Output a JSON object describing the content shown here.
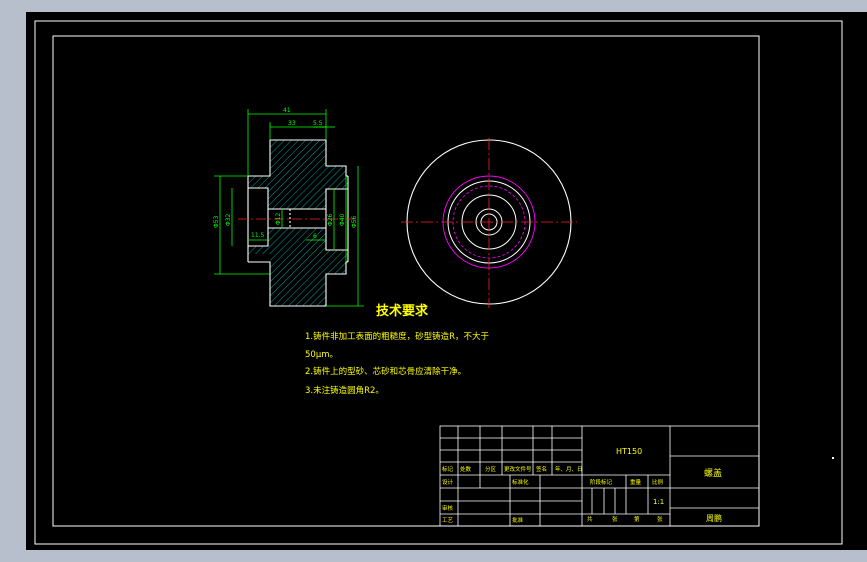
{
  "colors": {
    "background": "#000000",
    "frame": "#ffffff",
    "outline": "#ffffff",
    "dimension": "#00ff00",
    "hatch": "#00c8c8",
    "centerline": "#ff2020",
    "pitch": "#ff00ff",
    "note_text": "#ffff00"
  },
  "dimensions": {
    "overall_length": "41",
    "hub_length": "33",
    "step_length": "5.5",
    "bore_depth": "11.5",
    "inner_step": "6",
    "dia_left_outer": "Φ53",
    "dia_left_inner": "Φ32",
    "dia_bore": "Φ12",
    "dia_right_inner": "Φ26",
    "dia_right_mid": "Φ40",
    "dia_right_outer": "Φ56"
  },
  "notes": {
    "title": "技术要求",
    "line1": "1.铸件非加工表面的粗糙度，砂型铸造R，不大于",
    "line2": "50μm。",
    "line3": "2.铸件上的型砂、芯砂和芯骨应清除干净。",
    "line4": "3.未注铸造圆角R2。"
  },
  "title_block": {
    "material": "HT150",
    "part_name": "螺盖",
    "row_mark": "标记",
    "row_count": "处数",
    "row_zone": "分区",
    "row_change_doc": "更改文件号",
    "row_sign": "签名",
    "row_date": "年、月、日",
    "design": "设计",
    "standardize": "标准化",
    "review": "审核",
    "process": "工艺",
    "approve": "批准",
    "stage_mark": "阶段标记",
    "weight": "重量",
    "scale": "比例",
    "scale_value": "1:1",
    "total": "共",
    "sheet_zhang1": "张",
    "page": "第",
    "sheet_zhang2": "张",
    "signature": "周鹏"
  }
}
